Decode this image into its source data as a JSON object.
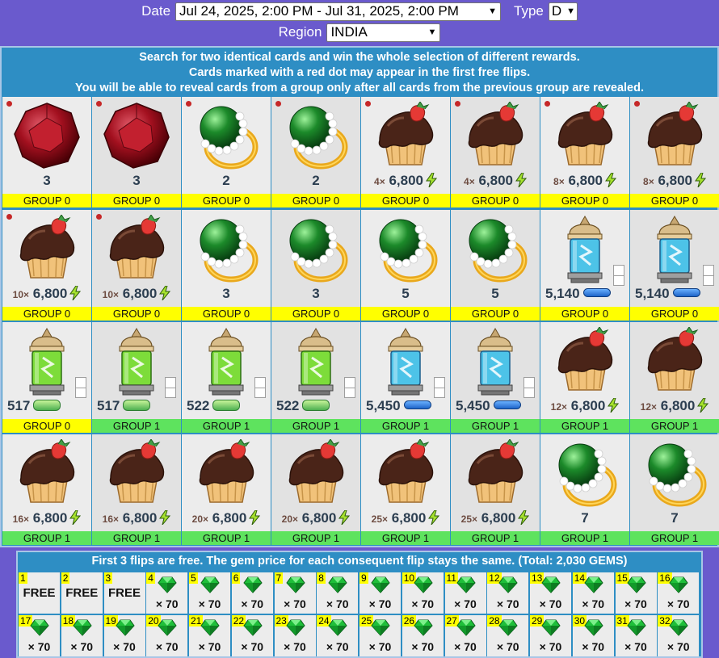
{
  "filters": {
    "date_label": "Date",
    "date_value": "Jul 24, 2025, 2:00 PM - Jul 31, 2025, 2:00 PM",
    "type_label": "Type",
    "type_value": "D",
    "region_label": "Region",
    "region_value": "INDIA"
  },
  "description": [
    "Search for two identical cards and win the whole selection of different rewards.",
    "Cards marked with a red dot may appear in the first free flips.",
    "You will be able to reveal cards from a group only after all cards from the previous group are revealed."
  ],
  "cards": [
    {
      "item": "ruby",
      "amount": "3",
      "group": "GROUP 0",
      "red_dot": true
    },
    {
      "item": "ruby",
      "amount": "3",
      "group": "GROUP 0",
      "red_dot": true
    },
    {
      "item": "emerald-ring",
      "amount": "2",
      "group": "GROUP 0",
      "red_dot": true
    },
    {
      "item": "emerald-ring",
      "amount": "2",
      "group": "GROUP 0",
      "red_dot": true
    },
    {
      "item": "cupcake",
      "multiplier": "4",
      "mult_sign": "×",
      "amount": "6,800",
      "unit": "energy",
      "group": "GROUP 0",
      "red_dot": true
    },
    {
      "item": "cupcake",
      "multiplier": "4",
      "mult_sign": "×",
      "amount": "6,800",
      "unit": "energy",
      "group": "GROUP 0",
      "red_dot": true
    },
    {
      "item": "cupcake",
      "multiplier": "8",
      "mult_sign": "×",
      "amount": "6,800",
      "unit": "energy",
      "group": "GROUP 0",
      "red_dot": true
    },
    {
      "item": "cupcake",
      "multiplier": "8",
      "mult_sign": "×",
      "amount": "6,800",
      "unit": "energy",
      "group": "GROUP 0",
      "red_dot": true
    },
    {
      "item": "cupcake",
      "multiplier": "10",
      "mult_sign": "×",
      "amount": "6,800",
      "unit": "energy",
      "group": "GROUP 0",
      "red_dot": true
    },
    {
      "item": "cupcake",
      "multiplier": "10",
      "mult_sign": "×",
      "amount": "6,800",
      "unit": "energy",
      "group": "GROUP 0",
      "red_dot": true
    },
    {
      "item": "emerald-ring",
      "amount": "3",
      "group": "GROUP 0",
      "red_dot": false
    },
    {
      "item": "emerald-ring",
      "amount": "3",
      "group": "GROUP 0",
      "red_dot": false
    },
    {
      "item": "emerald-ring",
      "amount": "5",
      "group": "GROUP 0",
      "red_dot": false
    },
    {
      "item": "emerald-ring",
      "amount": "5",
      "group": "GROUP 0",
      "red_dot": false
    },
    {
      "item": "capsule-blue",
      "amount": "5,140",
      "unit": "blue-capsule",
      "group": "GROUP 0",
      "red_dot": false
    },
    {
      "item": "capsule-blue",
      "amount": "5,140",
      "unit": "blue-capsule",
      "group": "GROUP 0",
      "red_dot": false
    },
    {
      "item": "capsule-green",
      "amount": "517",
      "unit": "green-capsule",
      "group": "GROUP 0",
      "red_dot": false
    },
    {
      "item": "capsule-green",
      "amount": "517",
      "unit": "green-capsule",
      "group": "GROUP 1",
      "red_dot": false
    },
    {
      "item": "capsule-green",
      "amount": "522",
      "unit": "green-capsule",
      "group": "GROUP 1",
      "red_dot": false
    },
    {
      "item": "capsule-green",
      "amount": "522",
      "unit": "green-capsule",
      "group": "GROUP 1",
      "red_dot": false
    },
    {
      "item": "capsule-blue",
      "amount": "5,450",
      "unit": "blue-capsule",
      "group": "GROUP 1",
      "red_dot": false
    },
    {
      "item": "capsule-blue",
      "amount": "5,450",
      "unit": "blue-capsule",
      "group": "GROUP 1",
      "red_dot": false
    },
    {
      "item": "cupcake",
      "multiplier": "12",
      "mult_sign": "×",
      "amount": "6,800",
      "unit": "energy",
      "group": "GROUP 1",
      "red_dot": false
    },
    {
      "item": "cupcake",
      "multiplier": "12",
      "mult_sign": "×",
      "amount": "6,800",
      "unit": "energy",
      "group": "GROUP 1",
      "red_dot": false
    },
    {
      "item": "cupcake",
      "multiplier": "16",
      "mult_sign": "×",
      "amount": "6,800",
      "unit": "energy",
      "group": "GROUP 1",
      "red_dot": false
    },
    {
      "item": "cupcake",
      "multiplier": "16",
      "mult_sign": "×",
      "amount": "6,800",
      "unit": "energy",
      "group": "GROUP 1",
      "red_dot": false
    },
    {
      "item": "cupcake",
      "multiplier": "20",
      "mult_sign": "×",
      "amount": "6,800",
      "unit": "energy",
      "group": "GROUP 1",
      "red_dot": false
    },
    {
      "item": "cupcake",
      "multiplier": "20",
      "mult_sign": "×",
      "amount": "6,800",
      "unit": "energy",
      "group": "GROUP 1",
      "red_dot": false
    },
    {
      "item": "cupcake",
      "multiplier": "25",
      "mult_sign": "×",
      "amount": "6,800",
      "unit": "energy",
      "group": "GROUP 1",
      "red_dot": false
    },
    {
      "item": "cupcake",
      "multiplier": "25",
      "mult_sign": "×",
      "amount": "6,800",
      "unit": "energy",
      "group": "GROUP 1",
      "red_dot": false
    },
    {
      "item": "emerald-ring",
      "amount": "7",
      "group": "GROUP 1",
      "red_dot": false
    },
    {
      "item": "emerald-ring",
      "amount": "7",
      "group": "GROUP 1",
      "red_dot": false
    }
  ],
  "flips": {
    "title": "First 3 flips are free. The gem price for each consequent flip stays the same. (Total: 2,030 GEMS)",
    "items": [
      {
        "n": "1",
        "free": "FREE"
      },
      {
        "n": "2",
        "free": "FREE"
      },
      {
        "n": "3",
        "free": "FREE"
      },
      {
        "n": "4",
        "price": "× 70"
      },
      {
        "n": "5",
        "price": "× 70"
      },
      {
        "n": "6",
        "price": "× 70"
      },
      {
        "n": "7",
        "price": "× 70"
      },
      {
        "n": "8",
        "price": "× 70"
      },
      {
        "n": "9",
        "price": "× 70"
      },
      {
        "n": "10",
        "price": "× 70"
      },
      {
        "n": "11",
        "price": "× 70"
      },
      {
        "n": "12",
        "price": "× 70"
      },
      {
        "n": "13",
        "price": "× 70"
      },
      {
        "n": "14",
        "price": "× 70"
      },
      {
        "n": "15",
        "price": "× 70"
      },
      {
        "n": "16",
        "price": "× 70"
      },
      {
        "n": "17",
        "price": "× 70"
      },
      {
        "n": "18",
        "price": "× 70"
      },
      {
        "n": "19",
        "price": "× 70"
      },
      {
        "n": "20",
        "price": "× 70"
      },
      {
        "n": "21",
        "price": "× 70"
      },
      {
        "n": "22",
        "price": "× 70"
      },
      {
        "n": "23",
        "price": "× 70"
      },
      {
        "n": "24",
        "price": "× 70"
      },
      {
        "n": "25",
        "price": "× 70"
      },
      {
        "n": "26",
        "price": "× 70"
      },
      {
        "n": "27",
        "price": "× 70"
      },
      {
        "n": "28",
        "price": "× 70"
      },
      {
        "n": "29",
        "price": "× 70"
      },
      {
        "n": "30",
        "price": "× 70"
      },
      {
        "n": "31",
        "price": "× 70"
      },
      {
        "n": "32",
        "price": "× 70"
      }
    ]
  },
  "colors": {
    "background": "#6a5acd",
    "panel": "#2e8ec4",
    "group0": "#ffff00",
    "group1": "#5ee35e",
    "gem": "#1fbf3a"
  }
}
